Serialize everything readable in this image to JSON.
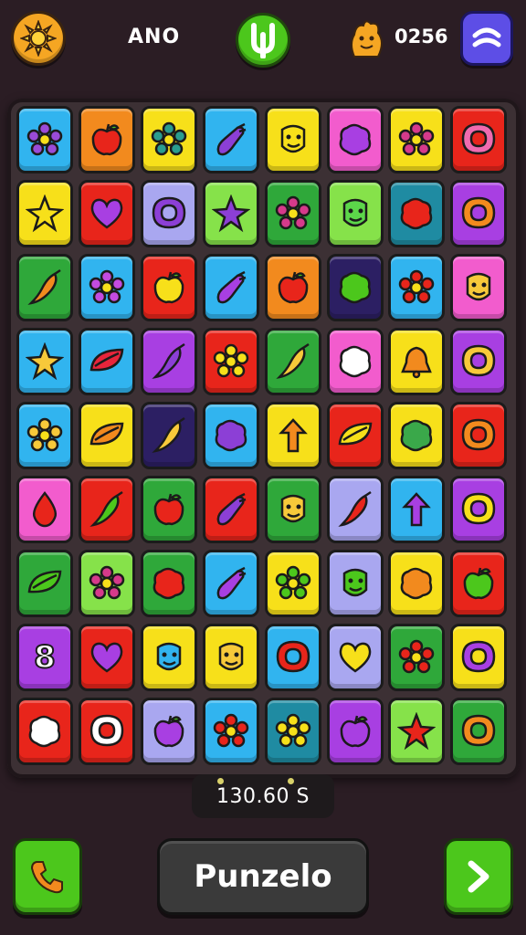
{
  "header": {
    "title_label": "ANO",
    "score": "0256"
  },
  "colors": {
    "blue": "#31b4ef",
    "orange": "#f28a1e",
    "yellow": "#f7e01a",
    "pink": "#f25ccd",
    "red": "#e8251b",
    "purple": "#a83fe2",
    "lightgreen": "#86e24a",
    "green": "#2fa83a",
    "teal": "#1f8ba2",
    "darknavy": "#2c1f63",
    "lavender": "#a9a7f0"
  },
  "board": {
    "rows": [
      [
        [
          "blue",
          "flower",
          "#9a4bd8"
        ],
        [
          "orange",
          "apple",
          "#e8251b"
        ],
        [
          "yellow",
          "flower",
          "#2a9d8f"
        ],
        [
          "blue",
          "eggplant",
          "#8c3fd6"
        ],
        [
          "yellow",
          "face",
          "#f7e01a"
        ],
        [
          "pink",
          "blob",
          "#a83fe2"
        ],
        [
          "yellow",
          "flower",
          "#d63a8b"
        ],
        [
          "red",
          "ring",
          "#f06ab0"
        ]
      ],
      [
        [
          "yellow",
          "star",
          "#f7e01a"
        ],
        [
          "red",
          "heart",
          "#a83fe2"
        ],
        [
          "lavender",
          "ring",
          "#8c3fd6"
        ],
        [
          "lightgreen",
          "star",
          "#8c3fd6"
        ],
        [
          "green",
          "flower",
          "#d63a8b"
        ],
        [
          "lightgreen",
          "face",
          "#5cd64a"
        ],
        [
          "teal",
          "blob",
          "#e8251b"
        ],
        [
          "purple",
          "ring",
          "#f28a1e"
        ]
      ],
      [
        [
          "green",
          "chili",
          "#f28a1e"
        ],
        [
          "blue",
          "flower",
          "#c44be0"
        ],
        [
          "red",
          "apple",
          "#f7e01a"
        ],
        [
          "blue",
          "eggplant",
          "#a83fe2"
        ],
        [
          "orange",
          "apple",
          "#e8251b"
        ],
        [
          "darknavy",
          "blob",
          "#4cc71c"
        ],
        [
          "blue",
          "flower",
          "#e8251b"
        ],
        [
          "pink",
          "face",
          "#f7c93a"
        ]
      ],
      [
        [
          "blue",
          "star",
          "#f7c93a"
        ],
        [
          "blue",
          "leaf",
          "#e8253b"
        ],
        [
          "purple",
          "chili",
          "#8c3fd6"
        ],
        [
          "red",
          "flower",
          "#f7e01a"
        ],
        [
          "green",
          "chili",
          "#f7c93a"
        ],
        [
          "pink",
          "blob",
          "#ffffff"
        ],
        [
          "yellow",
          "bell",
          "#f28a1e"
        ],
        [
          "purple",
          "ring",
          "#f7c93a"
        ]
      ],
      [
        [
          "blue",
          "flower",
          "#f7c93a"
        ],
        [
          "yellow",
          "leaf",
          "#f28a1e"
        ],
        [
          "darknavy",
          "chili",
          "#f7c93a"
        ],
        [
          "blue",
          "blob",
          "#8c3fd6"
        ],
        [
          "yellow",
          "arrow",
          "#f28a1e"
        ],
        [
          "red",
          "leaf",
          "#f7e01a"
        ],
        [
          "yellow",
          "blob",
          "#3aa84a"
        ],
        [
          "red",
          "ring",
          "#f28a1e"
        ]
      ],
      [
        [
          "pink",
          "drop",
          "#e8251b"
        ],
        [
          "red",
          "chili",
          "#4cc71c"
        ],
        [
          "green",
          "apple",
          "#e8251b"
        ],
        [
          "red",
          "eggplant",
          "#8c3fd6"
        ],
        [
          "green",
          "face",
          "#f7c93a"
        ],
        [
          "lavender",
          "chili",
          "#e8251b"
        ],
        [
          "blue",
          "arrow",
          "#a83fe2"
        ],
        [
          "purple",
          "ring",
          "#f7e01a"
        ]
      ],
      [
        [
          "green",
          "leaf",
          "#4cc71c"
        ],
        [
          "lightgreen",
          "flower",
          "#d63a8b"
        ],
        [
          "green",
          "blob",
          "#e8251b"
        ],
        [
          "blue",
          "eggplant",
          "#a83fe2"
        ],
        [
          "yellow",
          "flower",
          "#4cc71c"
        ],
        [
          "lavender",
          "face",
          "#4cc71c"
        ],
        [
          "yellow",
          "blob",
          "#f28a1e"
        ],
        [
          "red",
          "apple",
          "#4cc71c"
        ]
      ],
      [
        [
          "purple",
          "glyph8",
          "#ffffff"
        ],
        [
          "red",
          "heart",
          "#a83fe2"
        ],
        [
          "yellow",
          "face",
          "#31b4ef"
        ],
        [
          "yellow",
          "face",
          "#f7c93a"
        ],
        [
          "blue",
          "ring",
          "#e8251b"
        ],
        [
          "lavender",
          "heart",
          "#f7e01a"
        ],
        [
          "green",
          "flower",
          "#e8251b"
        ],
        [
          "yellow",
          "ring",
          "#a83fe2"
        ]
      ],
      [
        [
          "red",
          "blob",
          "#ffffff"
        ],
        [
          "red",
          "ring",
          "#ffffff"
        ],
        [
          "lavender",
          "apple",
          "#a83fe2"
        ],
        [
          "blue",
          "flower",
          "#e8251b"
        ],
        [
          "teal",
          "flower",
          "#f7e01a"
        ],
        [
          "purple",
          "apple",
          "#a83fe2"
        ],
        [
          "lightgreen",
          "star",
          "#e8251b"
        ],
        [
          "green",
          "ring",
          "#f28a1e"
        ]
      ]
    ]
  },
  "status": {
    "counter": "130.60 S"
  },
  "footer": {
    "main_button": "Punzelo"
  },
  "icons": {
    "top_left": "sun-icon",
    "top_center": "logo-icon",
    "top_right": "menu-icon",
    "mascot": "mascot-icon",
    "bottom_left": "phone-icon",
    "bottom_right": "chevron-right-icon"
  }
}
